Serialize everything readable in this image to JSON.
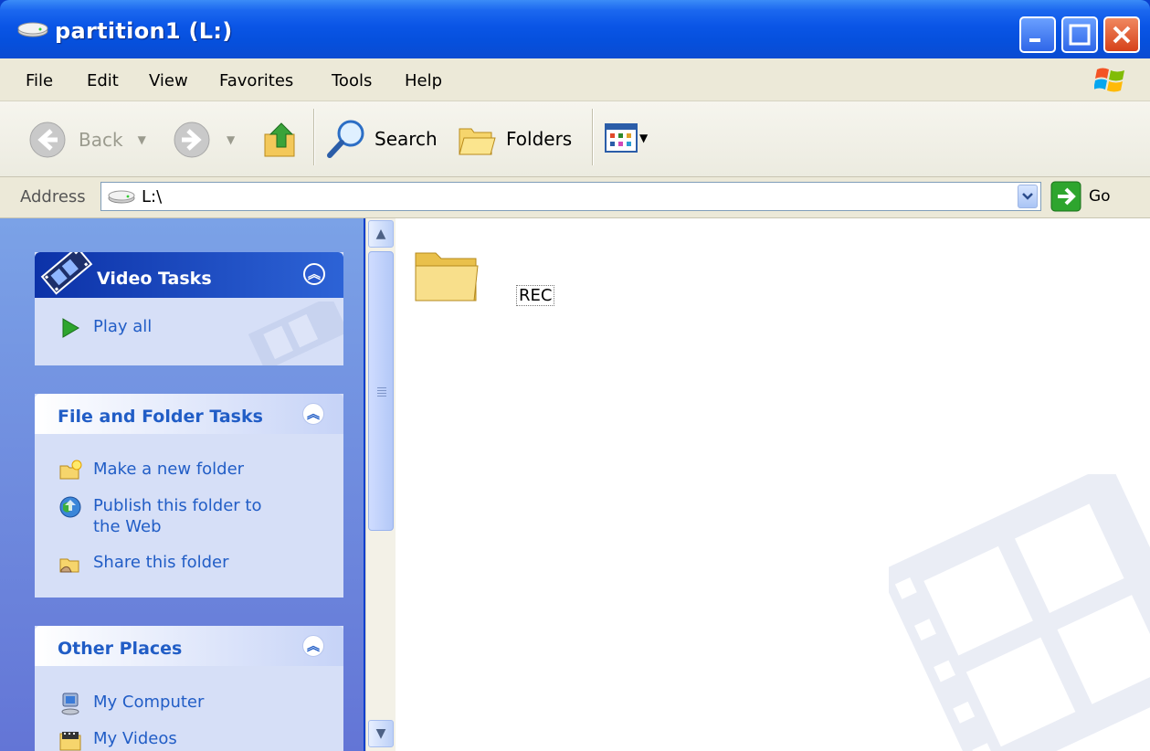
{
  "window": {
    "title": "partition1 (L:)"
  },
  "menu": {
    "items": [
      "File",
      "Edit",
      "View",
      "Favorites",
      "Tools",
      "Help"
    ]
  },
  "toolbar": {
    "back_label": "Back",
    "search_label": "Search",
    "folders_label": "Folders"
  },
  "address": {
    "label": "Address",
    "value": "L:\\",
    "go_label": "Go"
  },
  "task_pane": {
    "video_tasks": {
      "title": "Video Tasks",
      "items": [
        {
          "label": "Play all",
          "icon": "play-icon"
        }
      ]
    },
    "file_folder_tasks": {
      "title": "File and Folder Tasks",
      "items": [
        {
          "label": "Make a new folder",
          "icon": "new-folder-icon"
        },
        {
          "label": "Publish this folder to the Web",
          "icon": "publish-web-icon"
        },
        {
          "label": "Share this folder",
          "icon": "share-folder-icon"
        }
      ]
    },
    "other_places": {
      "title": "Other Places",
      "items": [
        {
          "label": "My Computer",
          "icon": "my-computer-icon"
        },
        {
          "label": "My Videos",
          "icon": "my-videos-icon"
        }
      ]
    }
  },
  "content": {
    "items": [
      {
        "name": "REC",
        "type": "folder"
      }
    ]
  },
  "colors": {
    "titlebar_blue": "#0a55e6",
    "link_blue": "#215dc6",
    "pane_blue": "#7ba2e7"
  }
}
